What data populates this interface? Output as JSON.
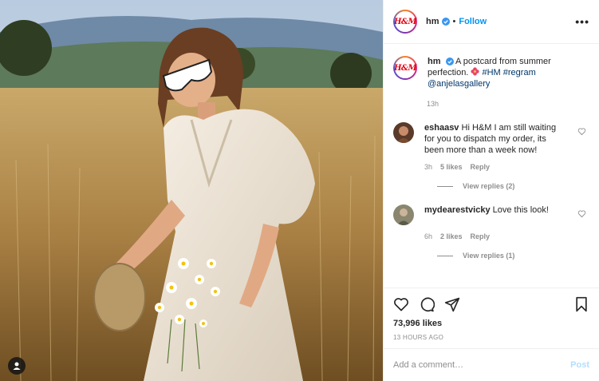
{
  "post": {
    "brand_color": "#e50010",
    "link_color": "#0095f6",
    "logo_text": "H&M",
    "username": "hm",
    "separator": "•",
    "follow_label": "Follow",
    "more_label": "•••"
  },
  "caption": {
    "username": "hm",
    "flower_icon": "hibiscus-emoji",
    "text_before": "A postcard from summer perfection.",
    "hashtags": "#HM #regram",
    "mention": "@anjelasgallery",
    "time": "13h"
  },
  "comments": [
    {
      "username": "eshaasv",
      "text": "Hi H&M I am still waiting for you to dispatch my order, its been more than a week now!",
      "time": "3h",
      "likes": "5 likes",
      "reply_label": "Reply",
      "view_replies": "View replies (2)"
    },
    {
      "username": "mydearestvicky",
      "text": "Love this look!",
      "time": "6h",
      "likes": "2 likes",
      "reply_label": "Reply",
      "view_replies": "View replies (1)"
    }
  ],
  "stats": {
    "likes": "73,996 likes",
    "posted": "13 HOURS AGO"
  },
  "composer": {
    "placeholder": "Add a comment…",
    "post_label": "Post"
  }
}
